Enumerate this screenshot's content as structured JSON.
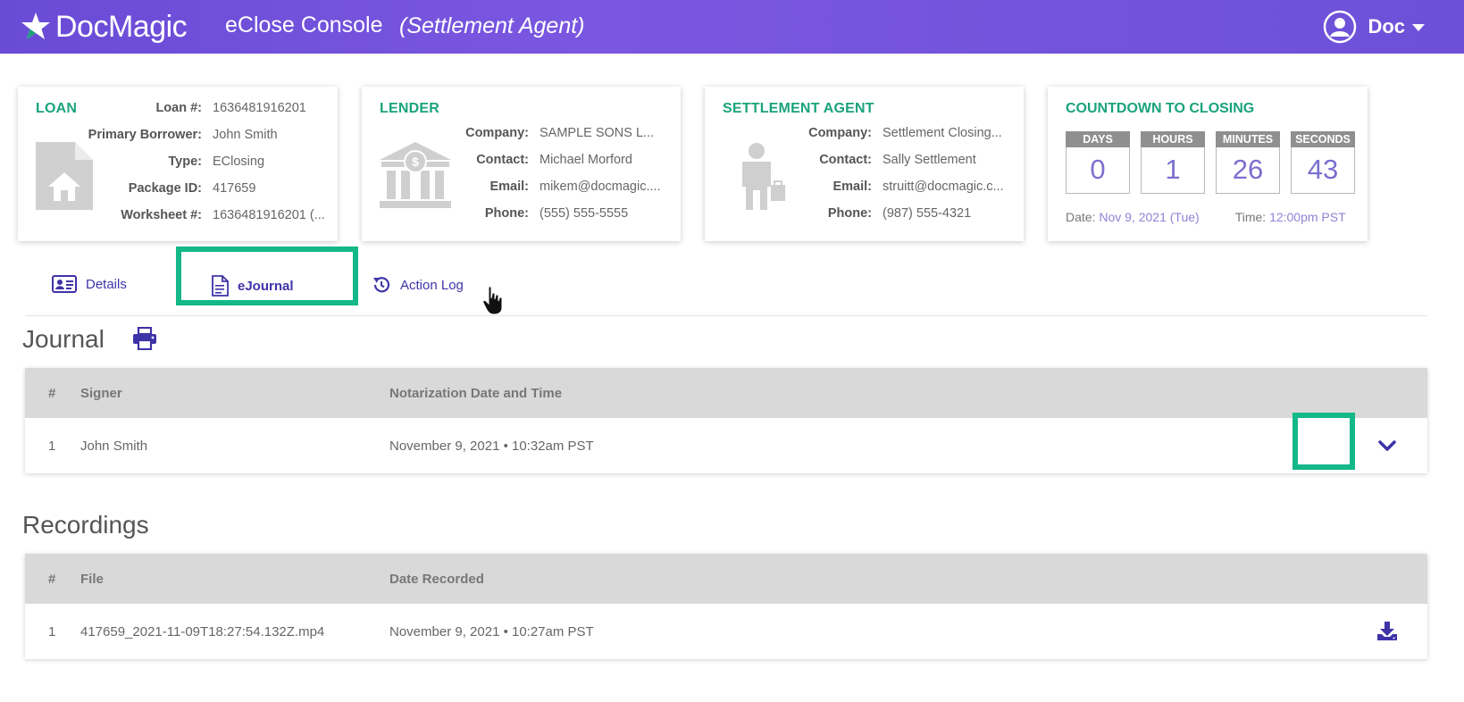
{
  "header": {
    "brand": "DocMagic",
    "console_title": "eClose Console",
    "role": "(Settlement Agent)",
    "user_name": "Doc",
    "colors": {
      "bg": "#6a4bd6",
      "accent_green": "#1aa37a",
      "link": "#3f33a8",
      "highlight": "#14b889"
    }
  },
  "loan": {
    "title": "LOAN",
    "fields": [
      {
        "label": "Loan #:",
        "value": "1636481916201"
      },
      {
        "label": "Primary Borrower:",
        "value": "John Smith"
      },
      {
        "label": "Type:",
        "value": "EClosing"
      },
      {
        "label": "Package ID:",
        "value": "417659"
      },
      {
        "label": "Worksheet #:",
        "value": "1636481916201 (..."
      }
    ],
    "icon": "house-document-icon"
  },
  "lender": {
    "title": "LENDER",
    "fields": [
      {
        "label": "Company:",
        "value": "SAMPLE SONS L..."
      },
      {
        "label": "Contact:",
        "value": "Michael Morford"
      },
      {
        "label": "Email:",
        "value": "mikem@docmagic...."
      },
      {
        "label": "Phone:",
        "value": "(555) 555-5555"
      }
    ],
    "icon": "bank-icon"
  },
  "settlement": {
    "title": "SETTLEMENT AGENT",
    "fields": [
      {
        "label": "Company:",
        "value": "Settlement Closing..."
      },
      {
        "label": "Contact:",
        "value": "Sally Settlement"
      },
      {
        "label": "Email:",
        "value": "struitt@docmagic.c..."
      },
      {
        "label": "Phone:",
        "value": "(987) 555-4321"
      }
    ],
    "icon": "person-briefcase-icon"
  },
  "countdown": {
    "title": "COUNTDOWN TO CLOSING",
    "units": [
      {
        "label": "DAYS",
        "value": "0"
      },
      {
        "label": "HOURS",
        "value": "1"
      },
      {
        "label": "MINUTES",
        "value": "26"
      },
      {
        "label": "SECONDS",
        "value": "43"
      }
    ],
    "date_label": "Date:",
    "date_value": "Nov 9, 2021 (Tue)",
    "time_label": "Time:",
    "time_value": "12:00pm PST"
  },
  "tabs": [
    {
      "label": "Details",
      "icon": "id-card-icon"
    },
    {
      "label": "eJournal",
      "icon": "document-icon",
      "active": true
    },
    {
      "label": "Action Log",
      "icon": "history-icon"
    }
  ],
  "journal": {
    "title": "Journal",
    "headers": {
      "num": "#",
      "main": "Signer",
      "date": "Notarization Date and Time"
    },
    "rows": [
      {
        "num": "1",
        "main": "John Smith",
        "date": "November 9, 2021 • 10:32am PST"
      }
    ]
  },
  "recordings": {
    "title": "Recordings",
    "headers": {
      "num": "#",
      "main": "File",
      "date": "Date Recorded"
    },
    "rows": [
      {
        "num": "1",
        "main": "417659_2021-11-09T18:27:54.132Z.mp4",
        "date": "November 9, 2021 • 10:27am PST"
      }
    ]
  }
}
